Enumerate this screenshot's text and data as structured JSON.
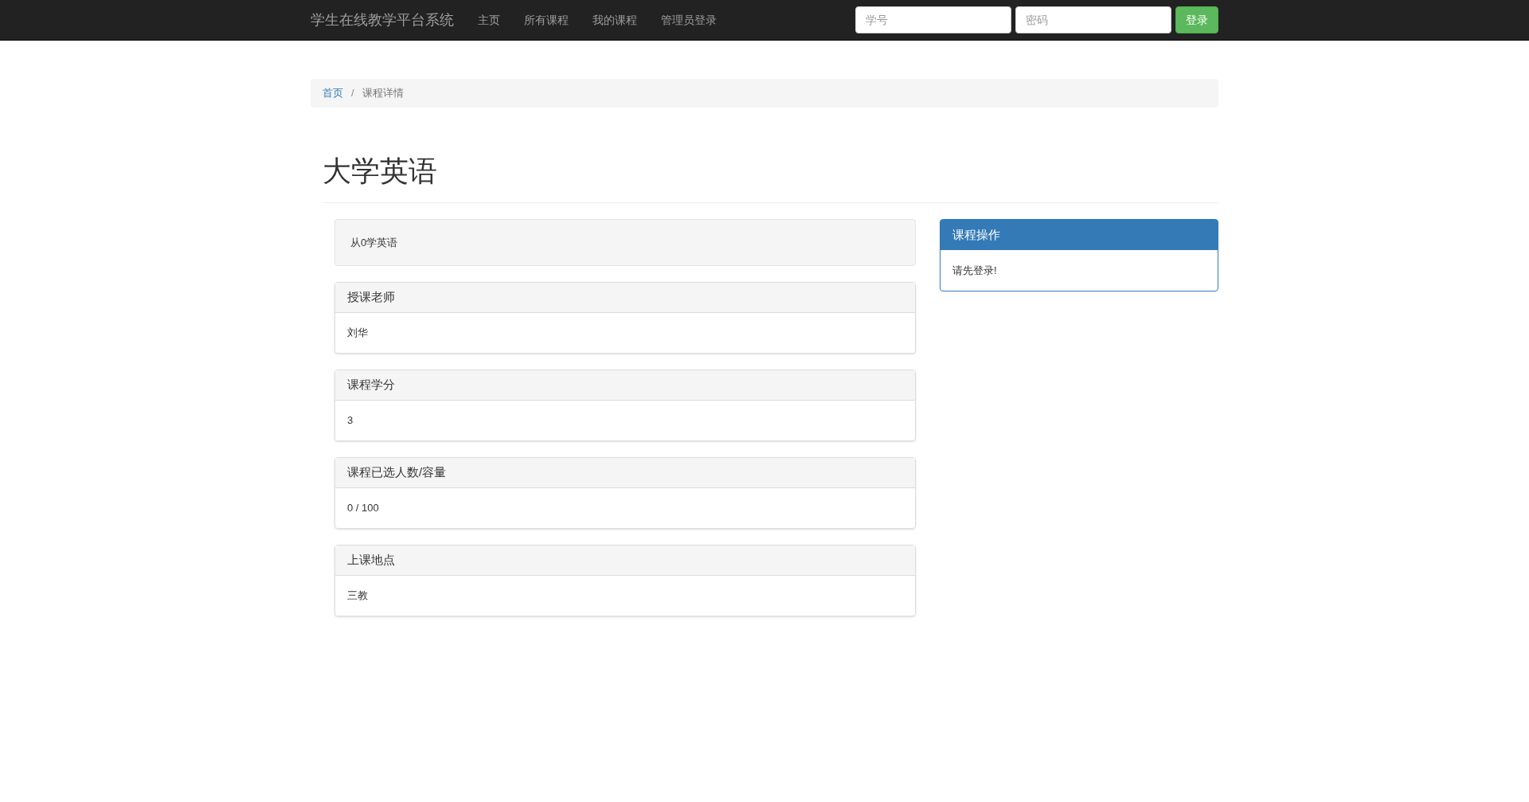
{
  "navbar": {
    "brand": "学生在线教学平台系统",
    "links": [
      "主页",
      "所有课程",
      "我的课程",
      "管理员登录"
    ],
    "login_form": {
      "student_id": {
        "placeholder": "学号"
      },
      "password": {
        "placeholder": "密码"
      },
      "button": "登录"
    }
  },
  "breadcrumb_separator": "/",
  "breadcrumb": [
    {
      "label": "首页",
      "kind": "link"
    },
    {
      "label": "课程详情",
      "kind": "current"
    }
  ],
  "course": {
    "title": "大学英语",
    "description": "从0学英语",
    "details": [
      {
        "heading": "授课老师",
        "value": "刘华"
      },
      {
        "heading": "课程学分",
        "value": "3"
      },
      {
        "heading": "课程已选人数/容量",
        "value": "0 / 100"
      },
      {
        "heading": "上课地点",
        "value": "三教"
      }
    ]
  },
  "actions_panel": {
    "heading": "课程操作",
    "message": "请先登录!"
  }
}
